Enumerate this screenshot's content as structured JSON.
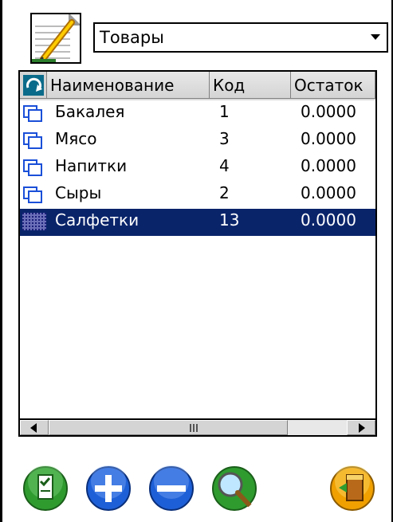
{
  "header": {
    "combo_value": "Товары"
  },
  "table": {
    "columns": [
      "Наименование",
      "Код",
      "Остаток"
    ],
    "rows": [
      {
        "name": "Бакалея",
        "code": "1",
        "rest": "0.0000",
        "icon": "folder-icon"
      },
      {
        "name": "Мясо",
        "code": "3",
        "rest": "0.0000",
        "icon": "folder-icon"
      },
      {
        "name": "Напитки",
        "code": "4",
        "rest": "0.0000",
        "icon": "folder-icon"
      },
      {
        "name": "Сыры",
        "code": "2",
        "rest": "0.0000",
        "icon": "folder-icon"
      },
      {
        "name": "Салфетки",
        "code": "13",
        "rest": "0.0000",
        "icon": "item-icon",
        "selected": true
      }
    ]
  },
  "scrollbar": {
    "left_arrow": "◀",
    "right_arrow": "▶",
    "grip": "|||"
  },
  "toolbar": {
    "buttons": [
      "checklist-icon",
      "add-icon",
      "remove-icon",
      "search-icon",
      "exit-icon"
    ]
  },
  "colors": {
    "selection": "#0a246a",
    "header_bg": "#d4d4d4",
    "green": "#2f9b2f",
    "blue": "#1d5fd6",
    "orange": "#f0a000"
  }
}
